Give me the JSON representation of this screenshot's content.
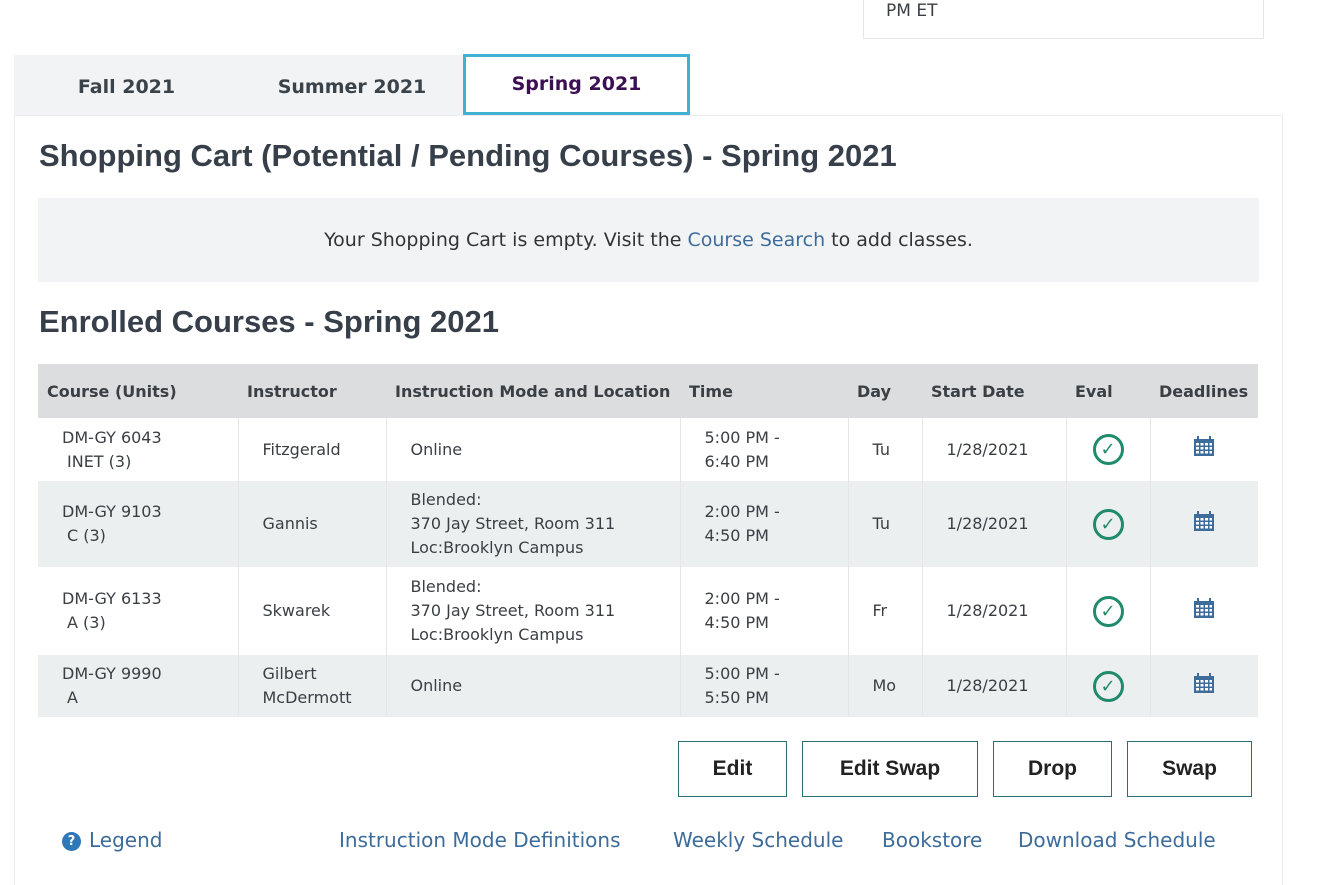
{
  "top_box": {
    "text": "PM ET"
  },
  "tabs": [
    {
      "label": "Fall 2021"
    },
    {
      "label": "Summer 2021"
    },
    {
      "label": "Spring 2021"
    }
  ],
  "cart": {
    "heading": "Shopping Cart (Potential / Pending Courses) - Spring 2021",
    "message_before": "Your Shopping Cart is empty. Visit the ",
    "link_text": "Course Search",
    "message_after": " to add classes."
  },
  "enrolled": {
    "heading": "Enrolled Courses - Spring 2021",
    "columns": [
      "Course (Units)",
      "Instructor",
      "Instruction Mode and Location",
      "Time",
      "Day",
      "Start Date",
      "Eval",
      "Deadlines"
    ],
    "rows": [
      {
        "course_line1": "DM-GY 6043",
        "course_line2": "INET (3)",
        "instructor_line1": "Fitzgerald",
        "instructor_line2": "",
        "mode_line1": "Online",
        "mode_line2": "",
        "mode_line3": "",
        "time_line1": "5:00 PM -",
        "time_line2": "6:40 PM",
        "day": "Tu",
        "start_date": "1/28/2021"
      },
      {
        "course_line1": "DM-GY 9103",
        "course_line2": "C (3)",
        "instructor_line1": "Gannis",
        "instructor_line2": "",
        "mode_line1": "Blended:",
        "mode_line2": "370 Jay Street, Room 311",
        "mode_line3": "Loc:Brooklyn Campus",
        "time_line1": "2:00 PM -",
        "time_line2": "4:50 PM",
        "day": "Tu",
        "start_date": "1/28/2021"
      },
      {
        "course_line1": "DM-GY 6133",
        "course_line2": "A (3)",
        "instructor_line1": "Skwarek",
        "instructor_line2": "",
        "mode_line1": "Blended:",
        "mode_line2": "370 Jay Street, Room 311",
        "mode_line3": "Loc:Brooklyn Campus",
        "time_line1": "2:00 PM -",
        "time_line2": "4:50 PM",
        "day": "Fr",
        "start_date": "1/28/2021"
      },
      {
        "course_line1": "DM-GY 9990",
        "course_line2": "A",
        "instructor_line1": "Gilbert",
        "instructor_line2": "McDermott",
        "mode_line1": "Online",
        "mode_line2": "",
        "mode_line3": "",
        "time_line1": "5:00 PM -",
        "time_line2": "5:50 PM",
        "day": "Mo",
        "start_date": "1/28/2021"
      }
    ],
    "eval_icon": "check-circle-icon",
    "deadline_icon": "calendar-icon"
  },
  "buttons": {
    "edit": "Edit",
    "edit_swap": "Edit Swap",
    "drop": "Drop",
    "swap": "Swap"
  },
  "footer": {
    "legend": "Legend",
    "help_glyph": "?",
    "links": [
      "Instruction Mode Definitions",
      "Weekly Schedule",
      "Bookstore",
      "Download Schedule"
    ]
  },
  "colors": {
    "accent": "#3fb1d2",
    "active_tab_text": "#3c0f52",
    "link": "#3d6c9a",
    "check": "#1f8b6c",
    "calendar": "#3d6c9a"
  }
}
